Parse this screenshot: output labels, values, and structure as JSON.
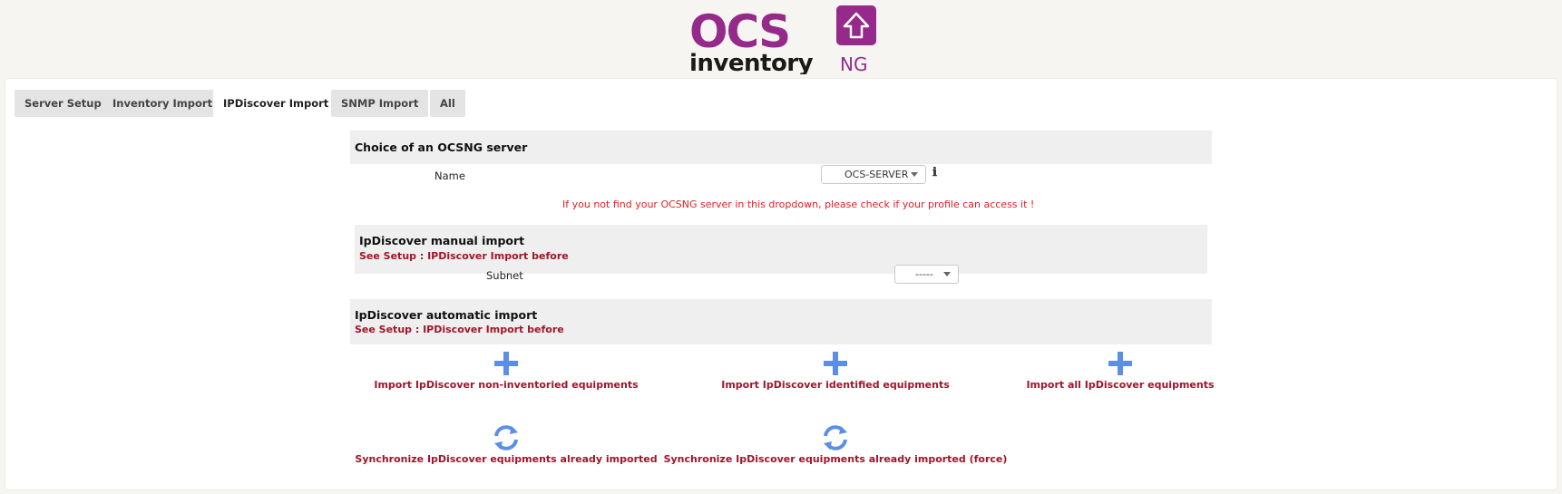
{
  "logo": {
    "text_top": "OCS",
    "text_bottom": "inventory",
    "suffix": "NG"
  },
  "tabs": [
    {
      "label": "Server Setup",
      "active": false
    },
    {
      "label": "Inventory Import",
      "active": false
    },
    {
      "label": "IPDiscover Import",
      "active": true
    },
    {
      "label": "SNMP Import",
      "active": false
    },
    {
      "label": "All",
      "active": false
    }
  ],
  "server_choice": {
    "title": "Choice of an OCSNG server",
    "name_label": "Name",
    "selected_server": "OCS-SERVER",
    "info_icon": "info-icon",
    "warning": "If you not find your OCSNG server in this dropdown, please check if your profile can access it !"
  },
  "manual_import": {
    "title": "IpDiscover manual import",
    "subtitle": "See Setup : IPDiscover Import before",
    "subnet_label": "Subnet",
    "selected_subnet": "-----"
  },
  "automatic_import": {
    "title": "IpDiscover automatic import",
    "subtitle": "See Setup : IPDiscover Import before",
    "actions": [
      {
        "label": "Import IpDiscover non-inventoried equipments",
        "icon": "plus-icon"
      },
      {
        "label": "Import IpDiscover identified equipments",
        "icon": "plus-icon"
      },
      {
        "label": "Import all IpDiscover equipments",
        "icon": "plus-icon"
      },
      {
        "label": "Synchronize IpDiscover equipments already imported",
        "icon": "sync-icon"
      },
      {
        "label": "Synchronize IpDiscover equipments already imported (force)",
        "icon": "sync-icon"
      }
    ]
  },
  "colors": {
    "brand_purple": "#962a8b",
    "accent_red": "#a0152a",
    "warning_red": "#e02020",
    "icon_blue": "#5b8fe6"
  }
}
